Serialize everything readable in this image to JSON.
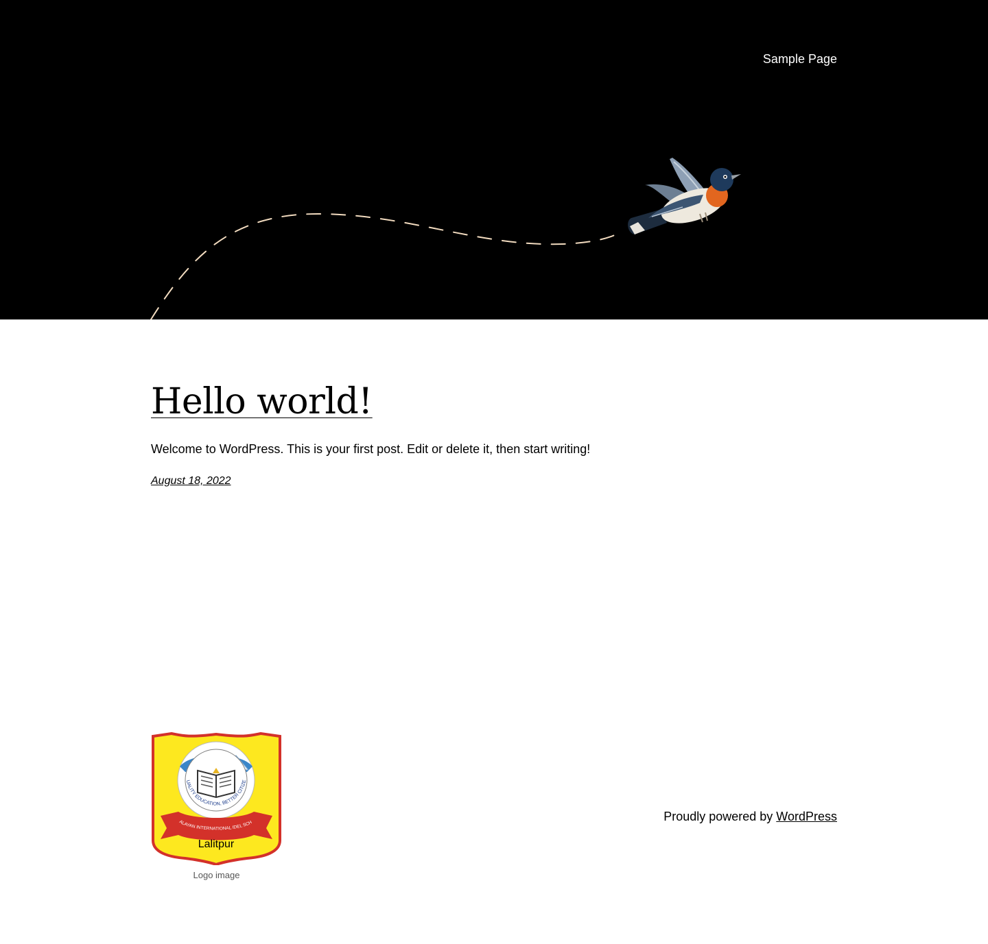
{
  "header": {
    "nav": {
      "sample_page": "Sample Page"
    },
    "background_color": "#000000",
    "path_color": "#f3dcc0"
  },
  "post": {
    "title": "Hello world!",
    "excerpt": "Welcome to WordPress. This is your first post. Edit or delete it, then start writing!",
    "date": "August 18, 2022"
  },
  "footer": {
    "logo": {
      "caption": "Logo image",
      "place_name": "Lalitpur",
      "motto": "\"QUALITY EDUCATION, BETTER CITIZEN\"",
      "school_name": "HIMALAYAN INTERNATIONAL IDEL SCHOOL"
    },
    "credit_prefix": "Proudly powered by",
    "credit_link": "WordPress"
  }
}
